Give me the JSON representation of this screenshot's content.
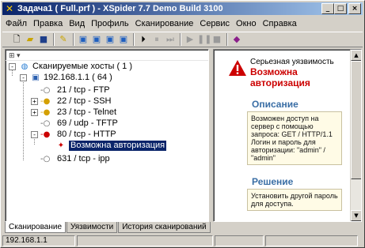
{
  "window": {
    "title": "Задача1 ( Full.prf ) - XSpider 7.7 Demo Build 3100",
    "title_icon": "x-logo-icon",
    "buttons": {
      "minimize": "_",
      "maximize": "□",
      "close": "×"
    }
  },
  "menu": [
    {
      "label": "Файл"
    },
    {
      "label": "Правка"
    },
    {
      "label": "Вид"
    },
    {
      "label": "Профиль"
    },
    {
      "label": "Сканирование"
    },
    {
      "label": "Сервис"
    },
    {
      "label": "Окно"
    },
    {
      "label": "Справка"
    }
  ],
  "toolbar": {
    "icons": [
      "new-icon",
      "open-icon",
      "save-icon",
      "profile-icon",
      "scan-host-icon",
      "scan-add-icon",
      "scan-remove-icon",
      "scan-run-icon",
      "step-icon",
      "pause-step-icon",
      "skip-icon",
      "play-icon",
      "pause-icon",
      "stop-icon",
      "report-icon"
    ]
  },
  "left_pane": {
    "header": "⊞ ▾",
    "root": {
      "label": "Сканируемые хосты ( 1 )"
    },
    "host": {
      "label": "192.168.1.1 ( 64 )"
    },
    "ports": [
      {
        "label": "21 / tcp - FTP",
        "expander": "",
        "status": "open"
      },
      {
        "label": "22 / tcp - SSH",
        "expander": "+",
        "status": "warn"
      },
      {
        "label": "23 / tcp - Telnet",
        "expander": "+",
        "status": "warn"
      },
      {
        "label": "69 / udp - TFTP",
        "expander": "",
        "status": "open"
      },
      {
        "label": "80 / tcp - HTTP",
        "expander": "-",
        "status": "vuln"
      },
      {
        "label": "631 / tcp - ipp",
        "expander": "",
        "status": "open"
      }
    ],
    "selected_vuln": "Возможна авторизация"
  },
  "right_pane": {
    "severity": "Серьезная уязвимость",
    "vuln_title": "Возможна авторизация",
    "description_heading": "Описание",
    "description": "Возможен доступ на сервер с помощью запроса: GET / HTTP/1.1 Логин и пароль для авторизации: \"admin\" / \"admin\"",
    "solution_heading": "Решение",
    "solution": "Установить другой пароль для доступа."
  },
  "tabs": [
    {
      "label": "Сканирование",
      "active": true
    },
    {
      "label": "Уязвимости",
      "active": false
    },
    {
      "label": "История сканирований",
      "active": false
    }
  ],
  "status": {
    "cells": [
      "192.168.1.1",
      "",
      "",
      ""
    ]
  },
  "colors": {
    "titlebar_start": "#0a246a",
    "titlebar_end": "#a6caf0",
    "vuln_red": "#cc0000",
    "heading_blue": "#3a6ea5"
  }
}
